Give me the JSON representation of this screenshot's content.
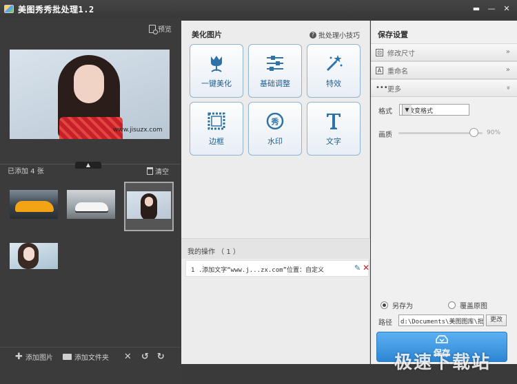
{
  "window": {
    "title": "美图秀秀批处理1.2",
    "controls": [
      "menu",
      "minimize",
      "close"
    ]
  },
  "left_panel": {
    "preview_label": "预览",
    "big_preview_watermark": "www.jisuzx.com",
    "added_count": "已添加 4 张",
    "clear_label": "清空",
    "thumbnails": [
      {
        "name": "orange-sports-car"
      },
      {
        "name": "white-car-showroom"
      },
      {
        "name": "woman-red-dress",
        "selected": true
      },
      {
        "name": "woman-portrait"
      }
    ],
    "bottom": {
      "add_image": "添加图片",
      "add_folder": "添加文件夹"
    }
  },
  "middle_panel": {
    "title": "美化图片",
    "tips_link": "批处理小技巧",
    "tools": [
      {
        "label": "一键美化",
        "icon": "tulip-icon"
      },
      {
        "label": "基础调整",
        "icon": "sliders-icon"
      },
      {
        "label": "特效",
        "icon": "magic-wand-icon"
      },
      {
        "label": "边框",
        "icon": "frame-icon"
      },
      {
        "label": "水印",
        "icon": "watermark-icon"
      },
      {
        "label": "文字",
        "icon": "text-icon"
      }
    ],
    "ops_header": "我的操作 （ 1 ）",
    "operations": [
      {
        "text": "1 .添加文字“www.j...zx.com”位置：自定义"
      }
    ]
  },
  "right_panel": {
    "title": "保存设置",
    "sections": [
      {
        "label": "修改尺寸",
        "chevron": "»"
      },
      {
        "label": "重命名",
        "chevron": "»"
      },
      {
        "label": "更多",
        "chevron": "»"
      }
    ],
    "format_label": "格式",
    "format_value": "不改变格式",
    "quality_label": "画质",
    "quality_value": "90%",
    "quality_level": 0.9,
    "save_as_label": "另存为",
    "overwrite_label": "覆盖原图",
    "path_label": "路径",
    "path_value": "d:\\Documents\\美图图库\\批处",
    "change_label": "更改",
    "save_label": "保存"
  },
  "site_watermark": "极速下载站"
}
